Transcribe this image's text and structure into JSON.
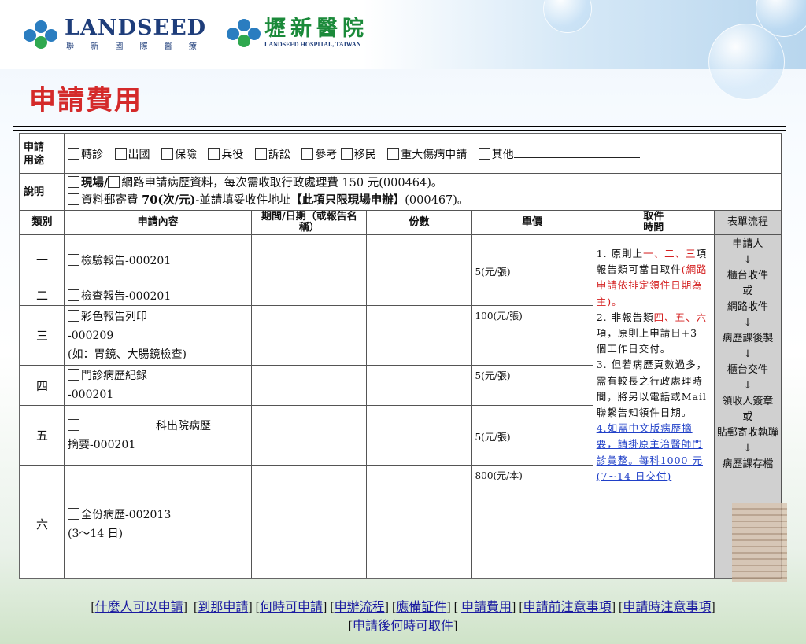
{
  "logo_left": {
    "en": "LANDSEED",
    "zh": "聯 新 國 際 醫 療"
  },
  "logo_right": {
    "zh": "壢新醫院",
    "en": "LANDSEED HOSPITAL, TAIWAN"
  },
  "page_title": "申請費用",
  "purpose": {
    "label": "申請\n用途",
    "options": [
      "轉診",
      "出國",
      "保險",
      "兵役",
      "訴訟",
      "參考",
      "移民",
      "重大傷病申請",
      "其他"
    ]
  },
  "description": {
    "label": "說明",
    "line1_bold": "現場/",
    "line1_rest": "網路申請病歷資料，每次需收取行政處理費 150 元(000464)。",
    "line2_a": "資料郵寄費 ",
    "line2_b": "70(次/元)",
    "line2_c": "-並請填妥收件地址",
    "line2_d": "【此項只限現場申辦】",
    "line2_e": "(000467)。"
  },
  "headers": {
    "category": "類別",
    "content": "申請內容",
    "period": "期間/日期（或報告名稱）",
    "copies": "份數",
    "unit_price": "單價",
    "pickup": "取件\n時間",
    "flow": "表單流程"
  },
  "rows": [
    {
      "cat": "一",
      "content": "檢驗報告-000201"
    },
    {
      "cat": "二",
      "content": "檢查報告-000201"
    },
    {
      "cat": "三",
      "content_a": "彩色報告列印",
      "content_b": "-000209",
      "content_c": "(如：胃鏡、大腸鏡檢查)",
      "price": "100(元/張)"
    },
    {
      "cat": "四",
      "content_a": "門診病歷紀錄",
      "content_b": "-000201",
      "price": "5(元/張)"
    },
    {
      "cat": "五",
      "content_a": "科出院病歷",
      "content_b": "摘要-000201",
      "price": "5(元/張)"
    },
    {
      "cat": "六",
      "content_a": "全份病歷-002013",
      "content_b": "(3～14 日)",
      "price": "800(元/本)"
    }
  ],
  "price_1_2": "5(元/張)",
  "pickup_text": {
    "p1a": "1. 原則上",
    "p1b": "一、二、三",
    "p1c": "項報告類可當日取件",
    "p1d": "(網路申請依排定領件日期為主)。",
    "p2a": "2. 非報告類",
    "p2b": "四、五、六",
    "p2c": "項，原則上申請日+3 個工作日交付。",
    "p3": "3. 但若病歷頁數過多，需有較長之行政處理時間，將另以電話或Mail聯繫告知領件日期。",
    "p4": "4.如需中文版病歷摘要，請掛原主治醫師門診彙整。每科1000 元(7~14 日交付)"
  },
  "flow_steps": [
    "申請人",
    "↓",
    "櫃台收件",
    "或",
    "網路收件",
    "↓",
    "病歷課後製",
    "↓",
    "櫃台交件",
    "↓",
    "領收人簽章",
    "或",
    "貼郵寄收執聯",
    "↓",
    "病歷課存檔"
  ],
  "nav": {
    "links": [
      "什麼人可以申請",
      "到那申請",
      "何時可申請",
      "申辦流程",
      "應備証件",
      "申請費用",
      "申請前注意事項",
      "申請時注意事項",
      "申請後何時可取件"
    ]
  }
}
